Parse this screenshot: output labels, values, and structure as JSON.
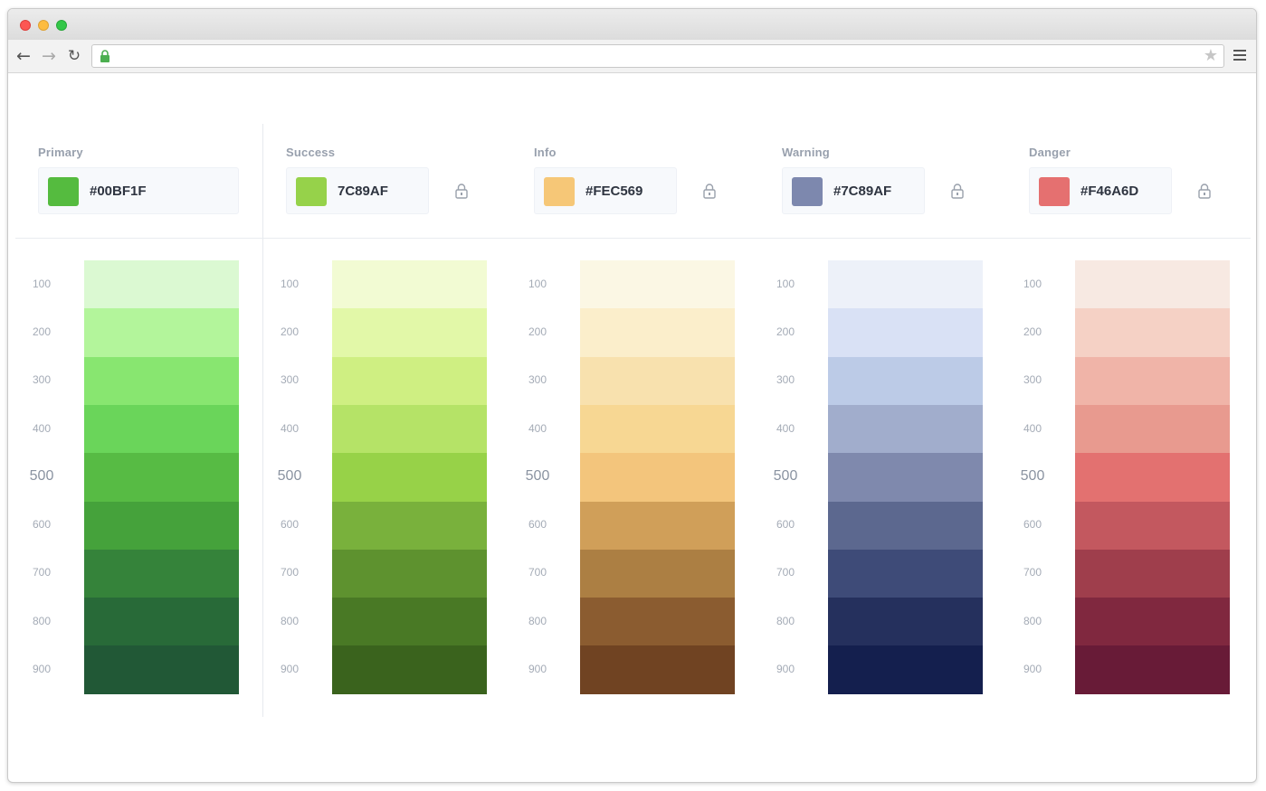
{
  "browser": {
    "back_glyph": "←",
    "forward_glyph": "→",
    "reload_glyph": "↻",
    "star_glyph": "★",
    "address_url": ""
  },
  "icons": {
    "address_lock": "lock-icon",
    "bookmark": "star-icon",
    "menu": "hamburger-menu-icon",
    "palette_lock": "lock-icon"
  },
  "scale_levels": [
    "100",
    "200",
    "300",
    "400",
    "500",
    "600",
    "700",
    "800",
    "900"
  ],
  "groups": [
    {
      "label": "Primary",
      "hex": "#00BF1F",
      "swatch": "#55bb3f",
      "locked_icon": false,
      "shades": [
        "#dbf9d2",
        "#b3f59b",
        "#88e670",
        "#6ad55a",
        "#57bb44",
        "#45a23b",
        "#35833a",
        "#286a38",
        "#215836"
      ]
    },
    {
      "label": "Success",
      "hex": "7C89AF",
      "swatch": "#96d24a",
      "locked_icon": true,
      "shades": [
        "#f2fbd3",
        "#e2f8a8",
        "#cfef82",
        "#b5e367",
        "#97d248",
        "#79b13c",
        "#5e922f",
        "#497925",
        "#3a631d"
      ]
    },
    {
      "label": "Info",
      "hex": "#FEC569",
      "swatch": "#f6c777",
      "locked_icon": true,
      "shades": [
        "#fbf7e4",
        "#fbeecb",
        "#f8e1ae",
        "#f7d793",
        "#f3c57c",
        "#d09f59",
        "#ac7f43",
        "#8b5c30",
        "#704322"
      ]
    },
    {
      "label": "Warning",
      "hex": "#7C89AF",
      "swatch": "#7d88ae",
      "locked_icon": true,
      "shades": [
        "#edf1f9",
        "#d9e1f5",
        "#bccbe7",
        "#a1adcc",
        "#7f89ad",
        "#5c688f",
        "#3e4b78",
        "#25305d",
        "#141f4e"
      ]
    },
    {
      "label": "Danger",
      "hex": "#F46A6D",
      "swatch": "#e57070",
      "locked_icon": true,
      "shades": [
        "#f7e9e2",
        "#f5d1c5",
        "#f0b4a8",
        "#e89a8f",
        "#e37170",
        "#c3585f",
        "#9f3e4c",
        "#80283f",
        "#681b37"
      ]
    }
  ]
}
